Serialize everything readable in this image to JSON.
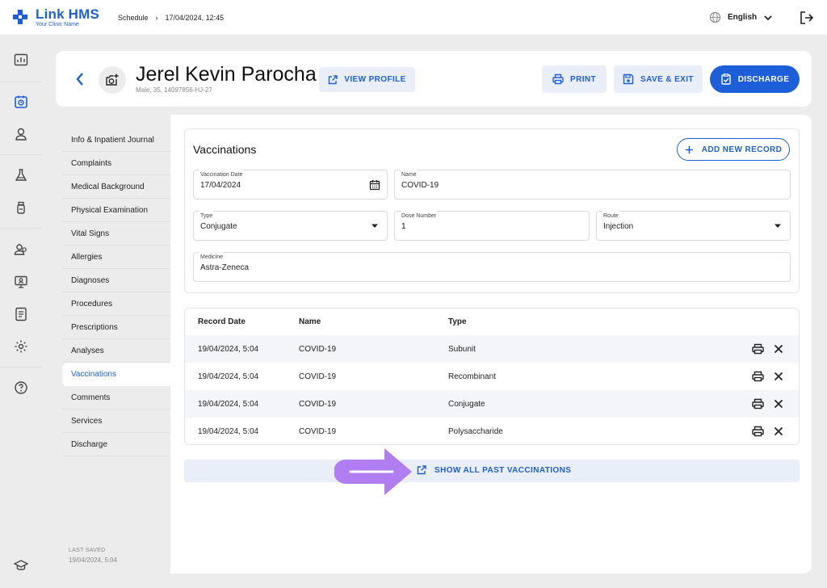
{
  "app": {
    "name": "Link HMS",
    "clinic": "Your Clinic Name"
  },
  "breadcrumb": {
    "section": "Schedule",
    "separator": "›",
    "current": "17/04/2024, 12:45"
  },
  "language": {
    "selected": "English"
  },
  "patient": {
    "name": "Jerel Kevin Parocha",
    "meta": "Male, 35, 14097856-HJ-27"
  },
  "header_buttons": {
    "view_profile": "VIEW PROFILE",
    "print": "PRINT",
    "save_exit": "SAVE & EXIT",
    "discharge": "DISCHARGE"
  },
  "sidebar": {
    "items": [
      {
        "label": "Info & Inpatient Journal"
      },
      {
        "label": "Complaints"
      },
      {
        "label": "Medical Background"
      },
      {
        "label": "Physical Examination"
      },
      {
        "label": "Vital Signs"
      },
      {
        "label": "Allergies"
      },
      {
        "label": "Diagnoses"
      },
      {
        "label": "Procedures"
      },
      {
        "label": "Prescriptions"
      },
      {
        "label": "Analyses"
      },
      {
        "label": "Vaccinations"
      },
      {
        "label": "Comments"
      },
      {
        "label": "Services"
      },
      {
        "label": "Discharge"
      }
    ],
    "active": "Vaccinations",
    "last_saved_label": "LAST SAVED",
    "last_saved_value": "19/04/2024, 5:04"
  },
  "vaccination_form": {
    "title": "Vaccinations",
    "add_button": "ADD NEW RECORD",
    "vaccination_date": {
      "label": "Vaccination Date",
      "value": "17/04/2024"
    },
    "name": {
      "label": "Name",
      "value": "COVID-19"
    },
    "type": {
      "label": "Type",
      "value": "Conjugate"
    },
    "dose_number": {
      "label": "Dose Number",
      "value": "1"
    },
    "route": {
      "label": "Route",
      "value": "Injection"
    },
    "medicine": {
      "label": "Medicine",
      "value": "Astra-Zeneca"
    }
  },
  "records_table": {
    "headers": {
      "record_date": "Record Date",
      "name": "Name",
      "type": "Type"
    },
    "rows": [
      {
        "record_date": "19/04/2024, 5:04",
        "name": "COVID-19",
        "type": "Subunit"
      },
      {
        "record_date": "19/04/2024, 5:04",
        "name": "COVID-19",
        "type": "Recombinant"
      },
      {
        "record_date": "19/04/2024, 5:04",
        "name": "COVID-19",
        "type": "Conjugate"
      },
      {
        "record_date": "19/04/2024, 5:04",
        "name": "COVID-19",
        "type": "Polysaccharide"
      }
    ]
  },
  "past_link": "SHOW ALL PAST VACCINATIONS",
  "colors": {
    "accent": "#1d5fd8",
    "accent_light": "#e9eef9",
    "arrow": "#b07ef0"
  }
}
